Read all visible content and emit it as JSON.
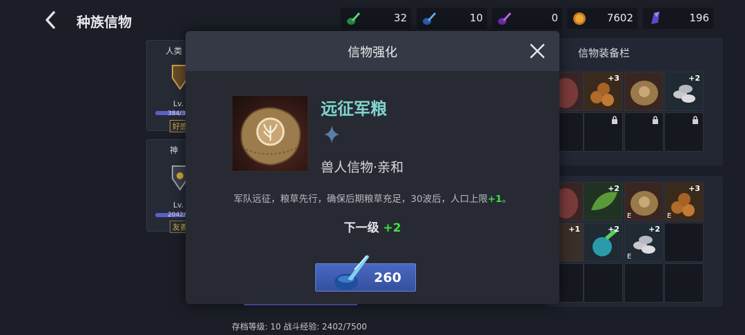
{
  "header": {
    "title": "种族信物"
  },
  "resources": [
    {
      "icon": "green-ink-icon",
      "value": "32",
      "color": "#3fbf5a"
    },
    {
      "icon": "blue-ink-icon",
      "value": "10",
      "color": "#3f8fe0"
    },
    {
      "icon": "purple-ink-icon",
      "value": "0",
      "color": "#a04fd8"
    },
    {
      "icon": "gold-coin-icon",
      "value": "7602",
      "color": "#d9932a"
    },
    {
      "icon": "purple-crystal-icon",
      "value": "196",
      "color": "#7a5fe0"
    }
  ],
  "background": {
    "cards": [
      {
        "name": "人类",
        "level": "Lv.",
        "progress": "384/3",
        "tag": "好感"
      },
      {
        "name": "神",
        "level": "Lv.",
        "progress": "2042/6",
        "tag": "友善"
      }
    ],
    "equip_panel_title": "信物装备栏",
    "slot_badges": [
      "+3",
      "+2",
      "+2",
      "+3",
      "+1",
      "+2",
      "+2"
    ],
    "slot_marker": "E",
    "footer": "存档等级: 10  战斗经验: 2402/7500"
  },
  "modal": {
    "title": "信物强化",
    "item_name": "远征军粮",
    "item_subtitle": "兽人信物·亲和",
    "description_prefix": "军队远征，粮草先行，确保后期粮草充足，30波后，人口上限",
    "description_bonus": "+1",
    "description_suffix": "。",
    "next_level_label": "下一级",
    "next_level_value": "+2",
    "upgrade_cost": "260"
  }
}
